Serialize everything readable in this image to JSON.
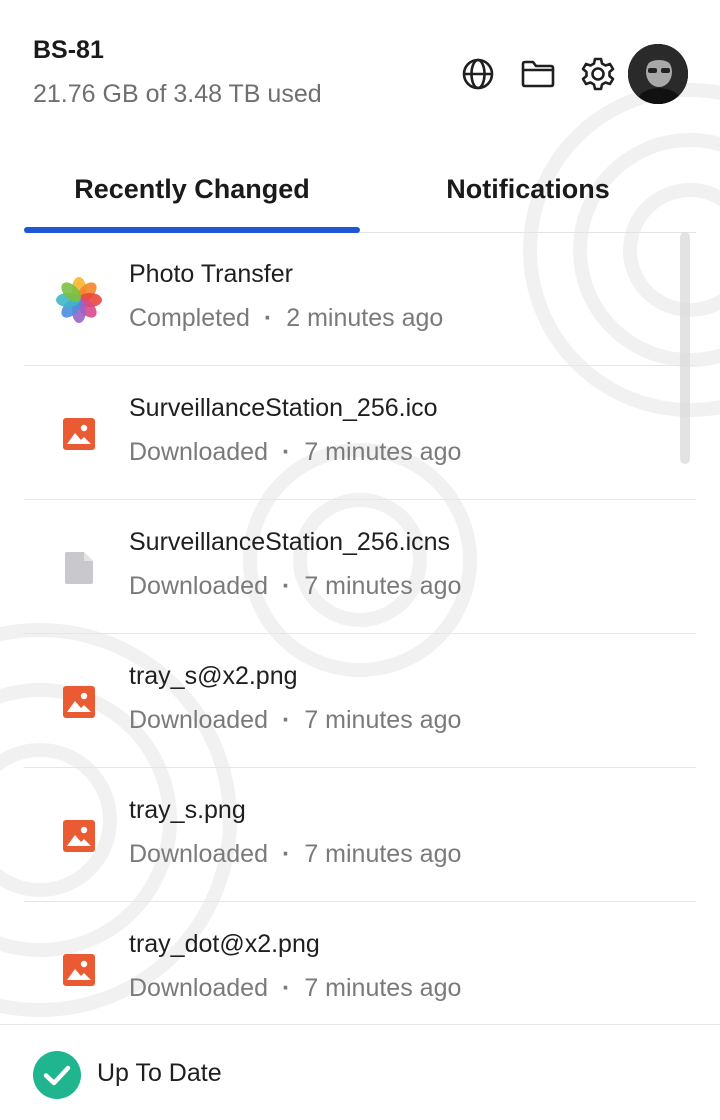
{
  "header": {
    "device_name": "BS-81",
    "usage": "21.76 GB of 3.48 TB used",
    "icons": [
      "globe-icon",
      "folder-icon",
      "gear-icon"
    ],
    "avatar": "user-avatar"
  },
  "tabs": [
    {
      "label": "Recently Changed",
      "active": true
    },
    {
      "label": "Notifications",
      "active": false
    }
  ],
  "items": [
    {
      "title": "Photo Transfer",
      "status": "Completed",
      "time": "2 minutes ago",
      "icon": "photos-app-icon"
    },
    {
      "title": "SurveillanceStation_256.ico",
      "status": "Downloaded",
      "time": "7 minutes ago",
      "icon": "image-file-icon"
    },
    {
      "title": "SurveillanceStation_256.icns",
      "status": "Downloaded",
      "time": "7 minutes ago",
      "icon": "generic-file-icon"
    },
    {
      "title": "tray_s@x2.png",
      "status": "Downloaded",
      "time": "7 minutes ago",
      "icon": "image-file-icon"
    },
    {
      "title": "tray_s.png",
      "status": "Downloaded",
      "time": "7 minutes ago",
      "icon": "image-file-icon"
    },
    {
      "title": "tray_dot@x2.png",
      "status": "Downloaded",
      "time": "7 minutes ago",
      "icon": "image-file-icon"
    }
  ],
  "footer": {
    "status": "Up To Date",
    "icon": "check-circle-icon"
  },
  "colors": {
    "accent": "#1e56d6",
    "image_icon": "#ea5a33",
    "generic_icon": "#c9c9cd",
    "status_ok": "#1fb58f"
  }
}
